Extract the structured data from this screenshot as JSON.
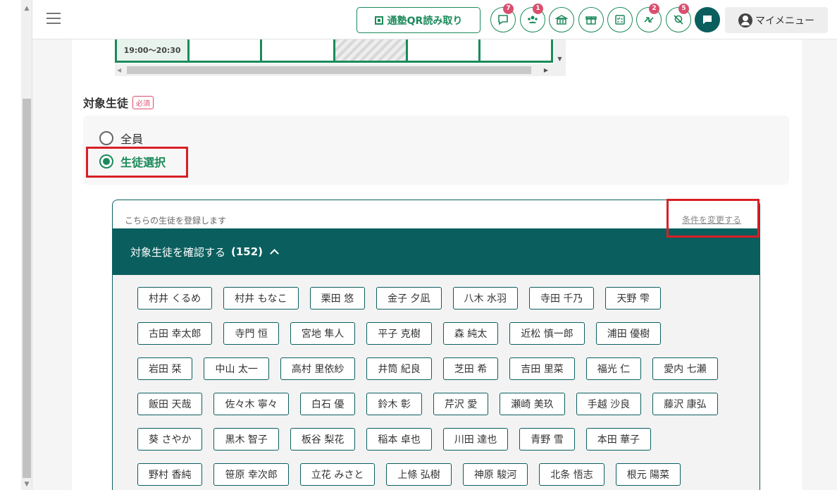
{
  "header": {
    "qr_button_label": "通塾QR読み取り",
    "icon_buttons": [
      {
        "name": "chat-icon",
        "badge": "7"
      },
      {
        "name": "users-icon",
        "badge": "1"
      },
      {
        "name": "school-icon",
        "badge": ""
      },
      {
        "name": "gift-icon",
        "badge": ""
      },
      {
        "name": "checklist-icon",
        "badge": ""
      },
      {
        "name": "transfer-icon",
        "badge": "2"
      },
      {
        "name": "location-off-icon",
        "badge": "5"
      },
      {
        "name": "message-icon",
        "badge": ""
      }
    ],
    "my_menu_label": "マイメニュー"
  },
  "schedule": {
    "time_label": "19:00～20:30"
  },
  "target_students": {
    "label": "対象生徒",
    "required_badge": "必須",
    "options": [
      "全員",
      "生徒選択"
    ],
    "selected_option": "生徒選択"
  },
  "student_box": {
    "register_note": "こちらの生徒を登録します",
    "change_link": "条件を変更する",
    "confirm_label": "対象生徒を確認する",
    "count": "(152)",
    "rows": [
      [
        "村井 くるめ",
        "村井 もなこ",
        "栗田 悠",
        "金子 夕凪",
        "八木 水羽",
        "寺田 千乃",
        "天野 雫"
      ],
      [
        "古田 幸太郎",
        "寺門 恒",
        "宮地 隼人",
        "平子 克樹",
        "森 純太",
        "近松 慎一郎",
        "浦田 優樹"
      ],
      [
        "岩田 栞",
        "中山 太一",
        "高村 里依紗",
        "井筒 紀良",
        "芝田 希",
        "吉田 里菜",
        "福光 仁",
        "愛内 七瀬"
      ],
      [
        "飯田 天哉",
        "佐々木 寧々",
        "白石 優",
        "鈴木 彰",
        "芹沢 愛",
        "瀬崎 美玖",
        "手越 沙良",
        "藤沢 康弘"
      ],
      [
        "葵 さやか",
        "黒木 智子",
        "板谷 梨花",
        "稲本 卓也",
        "川田 達也",
        "青野 雪",
        "本田 華子"
      ],
      [
        "野村 香純",
        "笹原 幸次郎",
        "立花 みさと",
        "上條 弘樹",
        "神原 駿河",
        "北条 悟志",
        "根元 陽菜"
      ]
    ]
  },
  "colors": {
    "brand_green": "#1b8a5a",
    "dark_teal": "#0b5e5e",
    "badge_pink": "#d9506f",
    "highlight_red": "#d81f26"
  }
}
